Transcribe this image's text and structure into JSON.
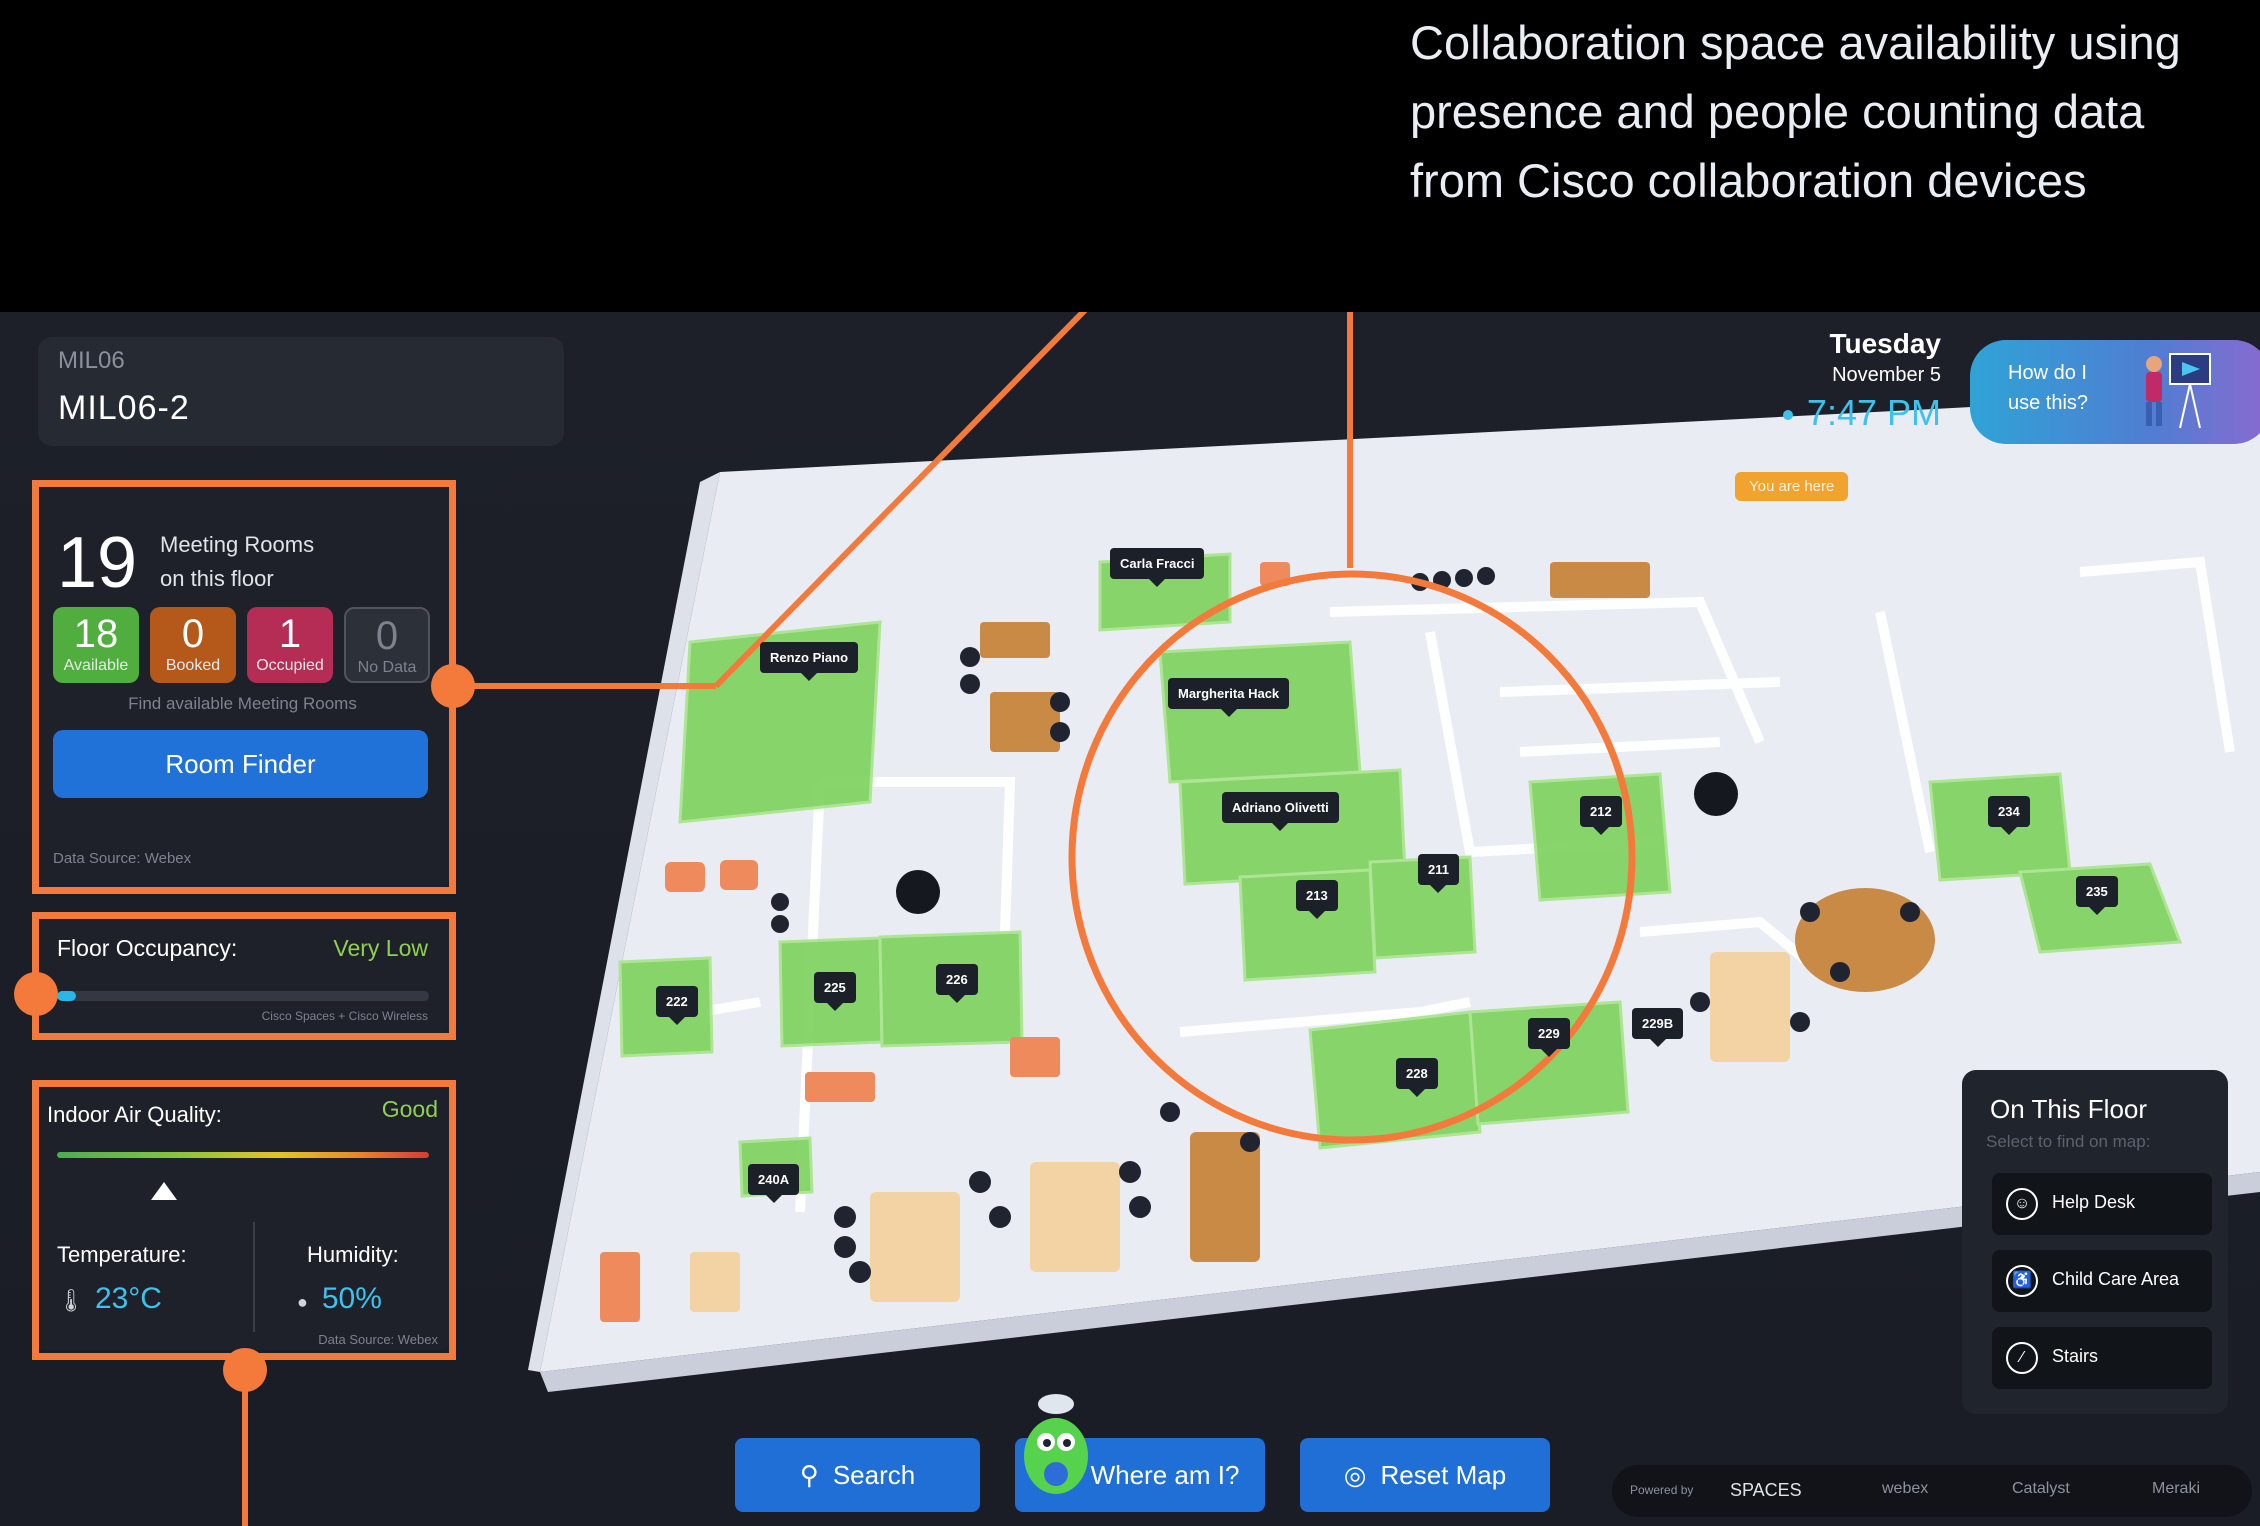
{
  "callout": {
    "lines": [
      "Collaboration space availability using",
      "presence and people counting data",
      "from Cisco collaboration devices"
    ]
  },
  "floor": {
    "code": "MIL06",
    "name": "MIL06-2"
  },
  "meeting_rooms": {
    "count": "19",
    "label_line1": "Meeting Rooms",
    "label_line2": "on this floor",
    "stats": [
      {
        "value": "18",
        "label": "Available",
        "color": "#4fae3e"
      },
      {
        "value": "0",
        "label": "Booked",
        "color": "#b4591a"
      },
      {
        "value": "1",
        "label": "Occupied",
        "color": "#b52c55"
      },
      {
        "value": "0",
        "label": "No Data",
        "color": "#2c3038"
      }
    ],
    "find_label": "Find available Meeting Rooms",
    "button": "Room Finder",
    "source": "Data Source: Webex"
  },
  "occupancy": {
    "title": "Floor Occupancy:",
    "value": "Very Low",
    "level_fraction": 0.05,
    "source": "Cisco Spaces + Cisco Wireless"
  },
  "air_quality": {
    "title": "Indoor Air Quality:",
    "value": "Good",
    "temperature_label": "Temperature:",
    "temperature_value": "23°C",
    "humidity_label": "Humidity:",
    "humidity_value": "50%",
    "source": "Data Source: Webex"
  },
  "datetime": {
    "day": "Tuesday",
    "date": "November 5",
    "time": "7:47 PM"
  },
  "help": {
    "line1": "How do I",
    "line2": "use this?"
  },
  "map": {
    "you_are_here": "You are here",
    "rooms": [
      "Carla Fracci",
      "Renzo Piano",
      "Margherita Hack",
      "Adriano Olivetti",
      "211",
      "212",
      "213",
      "222",
      "225",
      "226",
      "228",
      "229",
      "229B",
      "234",
      "235",
      "240A"
    ]
  },
  "on_this_floor": {
    "title": "On This Floor",
    "subtitle": "Select to find on map:",
    "items": [
      {
        "label": "Help Desk",
        "icon": "help-desk-icon"
      },
      {
        "label": "Child Care Area",
        "icon": "child-care-icon"
      },
      {
        "label": "Stairs",
        "icon": "stairs-icon"
      }
    ]
  },
  "bottom_bar": {
    "search": "Search",
    "where": "Where am I?",
    "reset": "Reset Map"
  },
  "powered": {
    "label": "Powered by",
    "brands": [
      "SPACES",
      "webex",
      "Catalyst",
      "Meraki"
    ]
  },
  "colors": {
    "accent": "#f47a3c",
    "primary": "#1f6fd6",
    "good": "#8fd14f",
    "info": "#3ec1ec"
  }
}
